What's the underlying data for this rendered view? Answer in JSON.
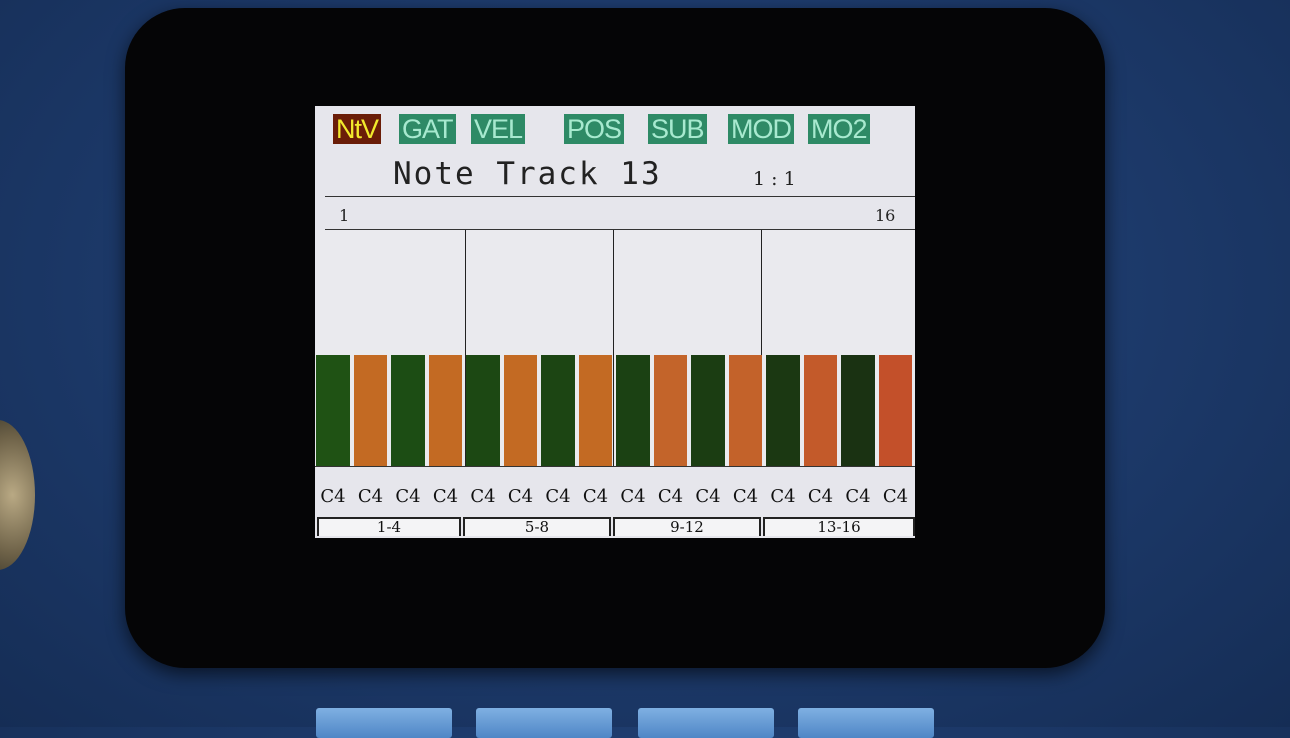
{
  "tabs": [
    {
      "label": "NtV",
      "active": true
    },
    {
      "label": "GAT",
      "active": false
    },
    {
      "label": "VEL",
      "active": false
    },
    {
      "label": "POS",
      "active": false
    },
    {
      "label": "SUB",
      "active": false
    },
    {
      "label": "MOD",
      "active": false
    },
    {
      "label": "MO2",
      "active": false
    }
  ],
  "header": {
    "title": "Note Track 13",
    "position": "1 :  1"
  },
  "ruler": {
    "start": "1",
    "end": "16"
  },
  "steps": [
    {
      "note": "C4",
      "color": "#1f5214",
      "value": 0.47
    },
    {
      "note": "C4",
      "color": "#c36a23",
      "value": 0.47
    },
    {
      "note": "C4",
      "color": "#1c4d14",
      "value": 0.47
    },
    {
      "note": "C4",
      "color": "#c36a23",
      "value": 0.47
    },
    {
      "note": "C4",
      "color": "#1c4813",
      "value": 0.47
    },
    {
      "note": "C4",
      "color": "#c36a23",
      "value": 0.47
    },
    {
      "note": "C4",
      "color": "#1c4513",
      "value": 0.47
    },
    {
      "note": "C4",
      "color": "#c36a23",
      "value": 0.47
    },
    {
      "note": "C4",
      "color": "#1b4113",
      "value": 0.47
    },
    {
      "note": "C4",
      "color": "#c3642a",
      "value": 0.47
    },
    {
      "note": "C4",
      "color": "#1b3d12",
      "value": 0.47
    },
    {
      "note": "C4",
      "color": "#c3622a",
      "value": 0.47
    },
    {
      "note": "C4",
      "color": "#1b3812",
      "value": 0.47
    },
    {
      "note": "C4",
      "color": "#c35a2a",
      "value": 0.47
    },
    {
      "note": "C4",
      "color": "#1a3212",
      "value": 0.47
    },
    {
      "note": "C4",
      "color": "#c3502a",
      "value": 0.47
    }
  ],
  "groups": [
    "1-4",
    "5-8",
    "9-12",
    "13-16"
  ],
  "colors": {
    "tab_bg": "#2e8a66",
    "tab_active_bg": "#6a1d08",
    "tab_active_text": "#f2ea2c",
    "screen_bg": "#e6e6ec"
  }
}
